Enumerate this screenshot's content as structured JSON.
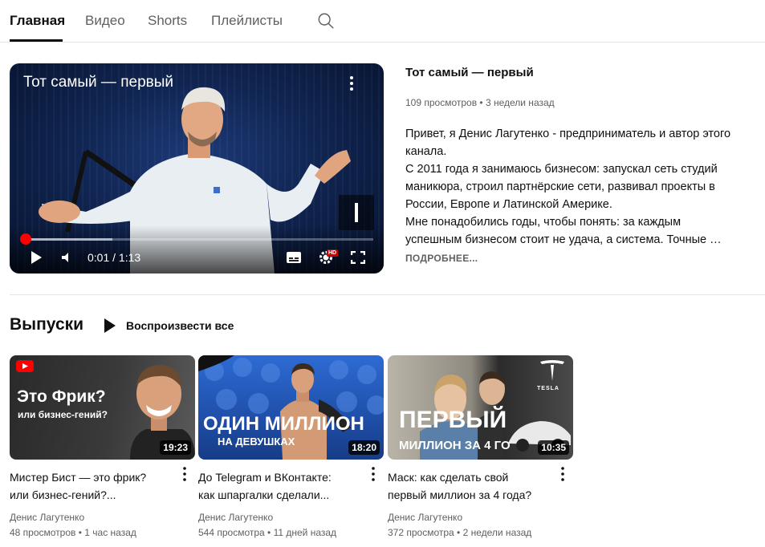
{
  "tabs": [
    {
      "label": "Главная",
      "active": true
    },
    {
      "label": "Видео",
      "active": false
    },
    {
      "label": "Shorts",
      "active": false
    },
    {
      "label": "Плейлисты",
      "active": false
    }
  ],
  "featured": {
    "player_title": "Тот самый — первый",
    "time": "0:01 / 1:13",
    "hd_badge": "HD",
    "progress_fraction": 0.003,
    "buffer_fraction": 0.25,
    "title": "Тот самый — первый",
    "meta": "109 просмотров • 3 недели назад",
    "description_lines": [
      "Привет, я Денис Лагутенко - предприниматель и автор этого",
      "канала.",
      "С 2011 года я занимаюсь бизнесом: запускал сеть студий",
      "маникюра, строил партнёрские сети, развивал проекты в",
      "России, Европе и Латинской Америке.",
      "Мне понадобились годы, чтобы понять: за каждым",
      "успешным бизнесом стоит не удача, а система. Точные …"
    ],
    "more_label": "ПОДРОБНЕЕ..."
  },
  "section": {
    "title": "Выпуски",
    "play_all_label": "Воспроизвести все"
  },
  "cards": [
    {
      "thumb_line1": "Это Фрик?",
      "thumb_line2": "или бизнес-гений?",
      "duration": "19:23",
      "title_line1": "Мистер Бист — это фрик?",
      "title_line2": "или бизнес-гений?...",
      "channel": "Денис Лагутенко",
      "meta": "48 просмотров • 1 час назад"
    },
    {
      "thumb_line1": "ОДИН МИЛЛИОН",
      "thumb_line2": "НА ДЕВУШКАХ",
      "duration": "18:20",
      "title_line1": "До Telegram и ВКонтакте:",
      "title_line2": "как шпаргалки сделали...",
      "channel": "Денис Лагутенко",
      "meta": "544 просмотра • 11 дней назад"
    },
    {
      "thumb_line1": "ПЕРВЫЙ",
      "thumb_line2": "МИЛЛИОН ЗА 4 ГО",
      "thumb_brand": "TESLA",
      "duration": "10:35",
      "title_line1": "Маск: как сделать свой",
      "title_line2": "первый миллион за 4 года?",
      "channel": "Денис Лагутенко",
      "meta": "372 просмотра • 2 недели назад"
    }
  ],
  "colors": {
    "accent_red": "#ff0000",
    "text_primary": "#0f0f0f",
    "text_secondary": "#606060"
  },
  "icons": [
    "search-icon",
    "more-vert-icon",
    "play-icon",
    "volume-icon",
    "subtitles-icon",
    "settings-icon",
    "fullscreen-icon",
    "youtube-logo-icon",
    "tesla-logo-icon"
  ]
}
